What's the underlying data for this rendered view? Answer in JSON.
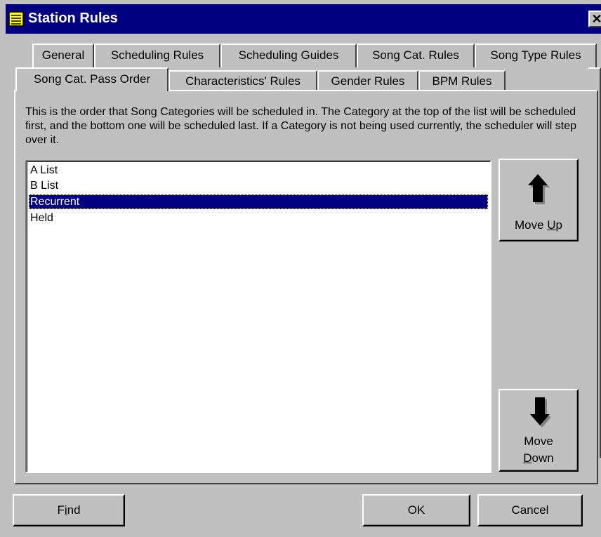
{
  "window": {
    "title": "Station Rules",
    "close_glyph": "✕"
  },
  "tabs": {
    "row1": [
      "General",
      "Scheduling Rules",
      "Scheduling Guides",
      "Song Cat. Rules",
      "Song Type Rules"
    ],
    "row2": [
      "Song Cat. Pass Order",
      "Characteristics' Rules",
      "Gender Rules",
      "BPM Rules"
    ],
    "active": "Song Cat. Pass Order"
  },
  "panel": {
    "description": "This is the order that Song Categories will be scheduled in. The Category at the top of the list will be scheduled first, and the bottom one will be scheduled last. If a Category is not being used currently, the scheduler will step over it."
  },
  "categories": {
    "items": [
      "A List",
      "B List",
      "Recurrent",
      "Held"
    ],
    "selected": "Recurrent"
  },
  "buttons": {
    "move_up": {
      "text": "Move ",
      "mnemonic": "U",
      "rest": "p",
      "icon": "up-arrow-icon"
    },
    "move_down": {
      "line1": "Move",
      "mnemonic": "D",
      "rest": "own",
      "icon": "down-arrow-icon"
    },
    "find": {
      "pre": "F",
      "mnemonic": "i",
      "rest": "nd"
    },
    "ok": "OK",
    "cancel": "Cancel"
  },
  "colors": {
    "face": "#c0c0c0",
    "title_bar": "#000080",
    "selection": "#000080"
  }
}
